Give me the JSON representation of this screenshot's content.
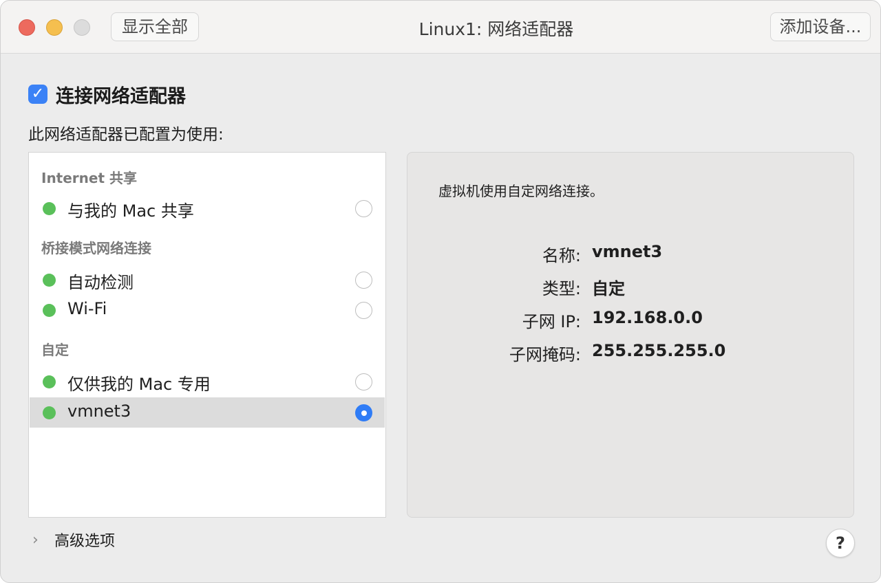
{
  "window": {
    "title": "Linux1: 网络适配器",
    "show_all_label": "显示全部",
    "add_device_label": "添加设备..."
  },
  "connect": {
    "checked": true,
    "label": "连接网络适配器"
  },
  "config_label": "此网络适配器已配置为使用:",
  "list": {
    "groups": [
      {
        "header": "Internet 共享",
        "items": [
          {
            "label": "与我的 Mac 共享",
            "status": "green",
            "selected": false
          }
        ]
      },
      {
        "header": "桥接模式网络连接",
        "items": [
          {
            "label": "自动检测",
            "status": "green",
            "selected": false
          },
          {
            "label": "Wi-Fi",
            "status": "green",
            "selected": false
          }
        ]
      },
      {
        "header": "自定",
        "items": [
          {
            "label": "仅供我的 Mac 专用",
            "status": "green",
            "selected": false
          },
          {
            "label": "vmnet3",
            "status": "green",
            "selected": true
          }
        ]
      }
    ]
  },
  "details": {
    "description": "虚拟机使用自定网络连接。",
    "name_key": "名称:",
    "name_value": "vmnet3",
    "type_key": "类型:",
    "type_value": "自定",
    "subnet_ip_key": "子网 IP:",
    "subnet_ip_value": "192.168.0.0",
    "subnet_mask_key": "子网掩码:",
    "subnet_mask_value": "255.255.255.0"
  },
  "advanced_label": "高级选项",
  "help_label": "?",
  "colors": {
    "accent": "#2f7cf6",
    "status_green": "#5ac05a",
    "close": "#ed6a5e",
    "minimize": "#f5bf4f",
    "maximize_disabled": "#dcdcdc"
  },
  "icons": {
    "checkbox": "checkmark-icon",
    "advanced": "chevron-right-icon"
  }
}
